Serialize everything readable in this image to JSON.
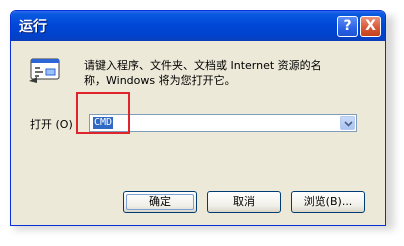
{
  "window": {
    "title": "运行",
    "help_button": "?",
    "close_button": "X"
  },
  "dialog": {
    "description_line1": "请键入程序、文件夹、文档或 Internet 资源的名",
    "description_line2": "称，Windows 将为您打开它。",
    "open_label": "打开 (O)",
    "open_value": "CMD"
  },
  "buttons": {
    "ok": "确定",
    "cancel": "取消",
    "browse": "浏览(B)..."
  },
  "colors": {
    "titlebar": "#0048d8",
    "dialog_bg": "#ece9d8",
    "selection": "#316ac5",
    "highlight_box": "#e0242b",
    "close_button": "#d85a3a"
  },
  "icons": {
    "run": "run-program-icon",
    "dropdown": "chevron-down-icon"
  }
}
